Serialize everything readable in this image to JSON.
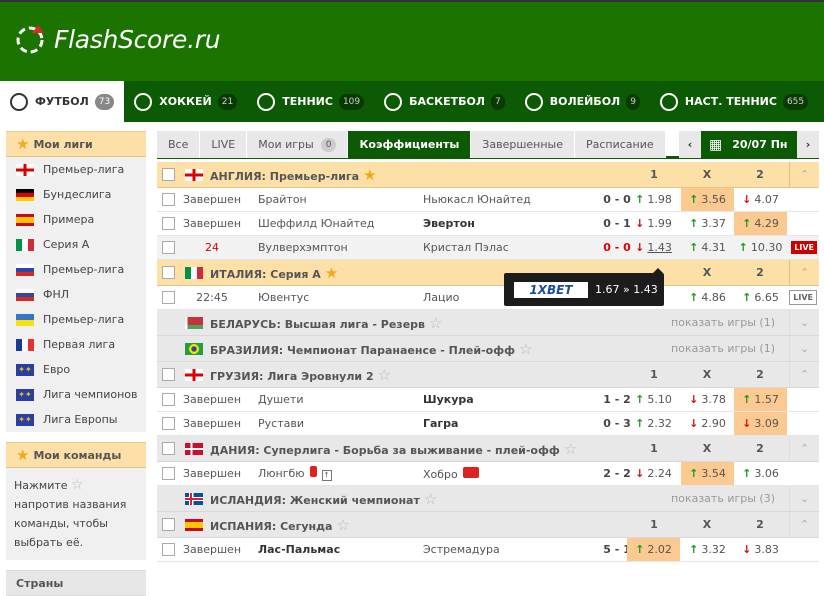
{
  "header": {
    "logo_text": "FlashScore.ru"
  },
  "nav": [
    {
      "label": "ФУТБОЛ",
      "count": "73",
      "icon": "soccer-ball-icon",
      "active": true
    },
    {
      "label": "ХОККЕЙ",
      "count": "21",
      "icon": "hockey-puck-icon"
    },
    {
      "label": "ТЕННИС",
      "count": "109",
      "icon": "tennis-ball-icon"
    },
    {
      "label": "БАСКЕТБОЛ",
      "count": "7",
      "icon": "basketball-icon"
    },
    {
      "label": "ВОЛЕЙБОЛ",
      "count": "9",
      "icon": "volleyball-icon"
    },
    {
      "label": "НАСТ. ТЕННИС",
      "count": "655",
      "icon": "table-tennis-icon"
    }
  ],
  "sidebar": {
    "my_leagues_title": "Мои лиги",
    "leagues": [
      {
        "label": "Премьер-лига",
        "flag": "england"
      },
      {
        "label": "Бундеслига",
        "flag": "germany"
      },
      {
        "label": "Примера",
        "flag": "spain"
      },
      {
        "label": "Серия А",
        "flag": "italy"
      },
      {
        "label": "Премьер-лига",
        "flag": "russia"
      },
      {
        "label": "ФНЛ",
        "flag": "russia"
      },
      {
        "label": "Премьер-лига",
        "flag": "ukraine"
      },
      {
        "label": "Первая лига",
        "flag": "france"
      },
      {
        "label": "Евро",
        "flag": "world"
      },
      {
        "label": "Лига чемпионов",
        "flag": "world"
      },
      {
        "label": "Лига Европы",
        "flag": "world"
      }
    ],
    "my_teams_title": "Мои команды",
    "my_teams_hint_1": "Нажмите",
    "my_teams_hint_2": "напротив названия команды, чтобы выбрать её.",
    "countries_title": "Страны"
  },
  "tabs": [
    {
      "label": "Все"
    },
    {
      "label": "LIVE"
    },
    {
      "label": "Мои игры",
      "count": "0"
    },
    {
      "label": "Коэффициенты",
      "active": true
    },
    {
      "label": "Завершенные"
    },
    {
      "label": "Расписание"
    }
  ],
  "date": "20/07 Пн",
  "odds_headers": [
    "1",
    "X",
    "2"
  ],
  "tooltip": {
    "bookmaker": "1XBET",
    "value": "1.67 » 1.43"
  },
  "colors": {
    "header": "#1b7300",
    "nav": "#0c5a04",
    "league_bg": "#fde0a8",
    "highlight": "#fcc991",
    "up": "#1a9a1a",
    "down": "#d01010",
    "live": "#cc0000"
  },
  "leagues": [
    {
      "name": "АНГЛИЯ: Премьер-лига",
      "flag": "england",
      "fav": true,
      "matches": [
        {
          "status": "Завершен",
          "home": "Брайтон",
          "away": "Ньюкасл Юнайтед",
          "score": "0 - 0",
          "odds": [
            [
              "up",
              "1.98"
            ],
            [
              "up",
              "3.56"
            ],
            [
              "dn",
              "4.07"
            ]
          ],
          "hl": 1
        },
        {
          "status": "Завершен",
          "home": "Шеффилд Юнайтед",
          "away": "Эвертон",
          "awayBold": true,
          "score": "0 - 1",
          "odds": [
            [
              "dn",
              "1.99"
            ],
            [
              "up",
              "3.37"
            ],
            [
              "up",
              "4.29"
            ]
          ],
          "hl": 2
        },
        {
          "status": "24",
          "live": true,
          "home": "Вулверхэмптон",
          "away": "Кристал Пэлас",
          "score": "0 - 0",
          "odds": [
            [
              "dn",
              "1.43"
            ],
            [
              "up",
              "4.31"
            ],
            [
              "up",
              "10.30"
            ]
          ],
          "hl": -1,
          "badge": "LIVE",
          "badgeOn": true
        }
      ]
    },
    {
      "name": "ИТАЛИЯ: Серия А",
      "flag": "italy",
      "fav": true,
      "matches": [
        {
          "status": "22:45",
          "home": "Ювентус",
          "away": "Лацио",
          "score": "",
          "odds": [
            [
              "",
              "8"
            ],
            [
              "up",
              "4.86"
            ],
            [
              "up",
              "6.65"
            ]
          ],
          "hl": -1,
          "badge": "LIVE"
        }
      ]
    },
    {
      "name": "БЕЛАРУСЬ: Высшая лига - Резерв",
      "flag": "belarus",
      "collapsed": true,
      "show": "показать игры (1)"
    },
    {
      "name": "БРАЗИЛИЯ: Чемпионат Паранаенсе - Плей-офф",
      "flag": "brazil",
      "collapsed": true,
      "show": "показать игры (1)"
    },
    {
      "name": "ГРУЗИЯ: Лига Эровнули 2",
      "flag": "georgia",
      "matches": [
        {
          "status": "Завершен",
          "home": "Душети",
          "away": "Шукура",
          "awayBold": true,
          "score": "1 - 2",
          "odds": [
            [
              "up",
              "5.10"
            ],
            [
              "dn",
              "3.78"
            ],
            [
              "up",
              "1.57"
            ]
          ],
          "hl": 2
        },
        {
          "status": "Завершен",
          "home": "Рустави",
          "away": "Гагра",
          "awayBold": true,
          "score": "0 - 3",
          "odds": [
            [
              "up",
              "2.32"
            ],
            [
              "dn",
              "2.90"
            ],
            [
              "dn",
              "3.09"
            ]
          ],
          "hl": 2
        }
      ]
    },
    {
      "name": "ДАНИЯ: Суперлига - Борьба за выживание - плей-офф",
      "flag": "denmark",
      "matches": [
        {
          "status": "Завершен",
          "home": "Люнгбю",
          "homeCards": 1,
          "homeSub": true,
          "away": "Хобро",
          "awayCards": 2,
          "score": "2 - 2",
          "odds": [
            [
              "dn",
              "2.24"
            ],
            [
              "up",
              "3.54"
            ],
            [
              "up",
              "3.06"
            ]
          ],
          "hl": 1
        }
      ]
    },
    {
      "name": "ИСЛАНДИЯ: Женский чемпионат",
      "flag": "iceland",
      "collapsed": true,
      "show": "показать игры (3)"
    },
    {
      "name": "ИСПАНИЯ: Сегунда",
      "flag": "spain",
      "matches": [
        {
          "status": "Завершен",
          "home": "Лас-Пальмас",
          "homeBold": true,
          "away": "Эстремадура",
          "score": "5 - 1",
          "odds": [
            [
              "up",
              "2.02"
            ],
            [
              "up",
              "3.32"
            ],
            [
              "dn",
              "3.83"
            ]
          ],
          "hl": 0
        }
      ]
    }
  ]
}
